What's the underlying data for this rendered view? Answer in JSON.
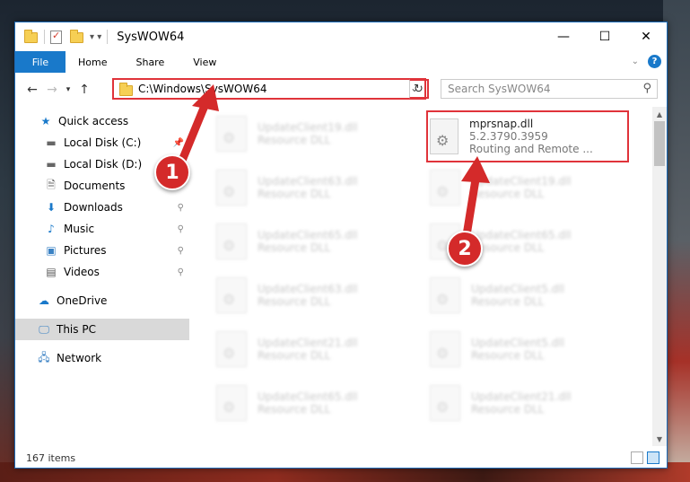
{
  "window": {
    "title": "SysWOW64",
    "controls": {
      "minimize": "—",
      "maximize": "☐",
      "close": "✕"
    }
  },
  "ribbon": {
    "tabs": [
      "File",
      "Home",
      "Share",
      "View"
    ]
  },
  "address": {
    "path": "C:\\Windows\\SysWOW64",
    "search_placeholder": "Search SysWOW64"
  },
  "sidebar": {
    "items": [
      {
        "label": "Quick access",
        "icon": "star-icon"
      },
      {
        "label": "Local Disk (C:)",
        "icon": "drive-icon"
      },
      {
        "label": "Local Disk (D:)",
        "icon": "drive-icon"
      },
      {
        "label": "Documents",
        "icon": "document-icon"
      },
      {
        "label": "Downloads",
        "icon": "download-icon"
      },
      {
        "label": "Music",
        "icon": "music-icon"
      },
      {
        "label": "Pictures",
        "icon": "picture-icon"
      },
      {
        "label": "Videos",
        "icon": "video-icon"
      },
      {
        "label": "OneDrive",
        "icon": "cloud-icon"
      },
      {
        "label": "This PC",
        "icon": "computer-icon"
      },
      {
        "label": "Network",
        "icon": "network-icon"
      }
    ]
  },
  "files": {
    "left_column": [
      {
        "name": "UpdateClient19.dll",
        "desc": "Resource DLL"
      },
      {
        "name": "UpdateClient63.dll",
        "desc": "Resource DLL"
      },
      {
        "name": "UpdateClient65.dll",
        "desc": "Resource DLL"
      },
      {
        "name": "UpdateClient63.dll",
        "desc": "Resource DLL"
      },
      {
        "name": "UpdateClient21.dll",
        "desc": "Resource DLL"
      },
      {
        "name": "UpdateClient65.dll",
        "desc": "Resource DLL"
      }
    ],
    "highlighted": {
      "name": "mprsnap.dll",
      "version": "5.2.3790.3959",
      "desc": "Routing and Remote ..."
    },
    "right_column": [
      {
        "name": "UpdateClient19.dll",
        "desc": "Resource DLL"
      },
      {
        "name": "UpdateClient65.dll",
        "desc": "Resource DLL"
      },
      {
        "name": "UpdateClient5.dll",
        "desc": "Resource DLL"
      },
      {
        "name": "UpdateClient5.dll",
        "desc": "Resource DLL"
      },
      {
        "name": "UpdateClient21.dll",
        "desc": "Resource DLL"
      }
    ]
  },
  "status": {
    "item_count": "167 items"
  },
  "callouts": {
    "step1": "1",
    "step2": "2",
    "color": "#d42a2a"
  },
  "colors": {
    "accent": "#1979ca",
    "highlight": "#e0333a"
  }
}
